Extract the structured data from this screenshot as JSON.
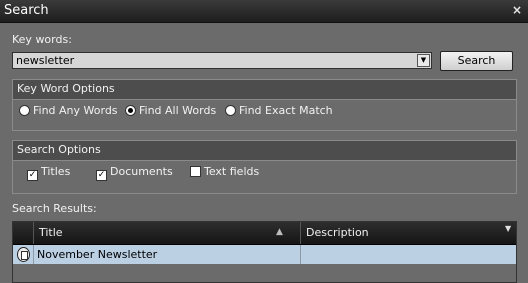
{
  "window": {
    "title": "Search",
    "close_glyph": "×"
  },
  "keywords": {
    "label": "Key words:",
    "value": "newsletter",
    "dropdown_glyph": "▼",
    "search_button": "Search"
  },
  "keyword_options": {
    "header": "Key Word Options",
    "options": [
      {
        "label": "Find Any Words",
        "selected": false
      },
      {
        "label": "Find All Words",
        "selected": true
      },
      {
        "label": "Find Exact Match",
        "selected": false
      }
    ]
  },
  "search_options": {
    "header": "Search Options",
    "options": [
      {
        "label": "Titles",
        "checked": true
      },
      {
        "label": "Documents",
        "checked": true
      },
      {
        "label": "Text fields",
        "checked": false
      }
    ]
  },
  "results": {
    "label": "Search Results:",
    "columns": {
      "title": "Title",
      "description": "Description"
    },
    "sort_glyph": "▲",
    "filter_glyph": "▼",
    "rows": [
      {
        "icon": "document-icon",
        "title": "November Newsletter",
        "description": ""
      }
    ]
  }
}
